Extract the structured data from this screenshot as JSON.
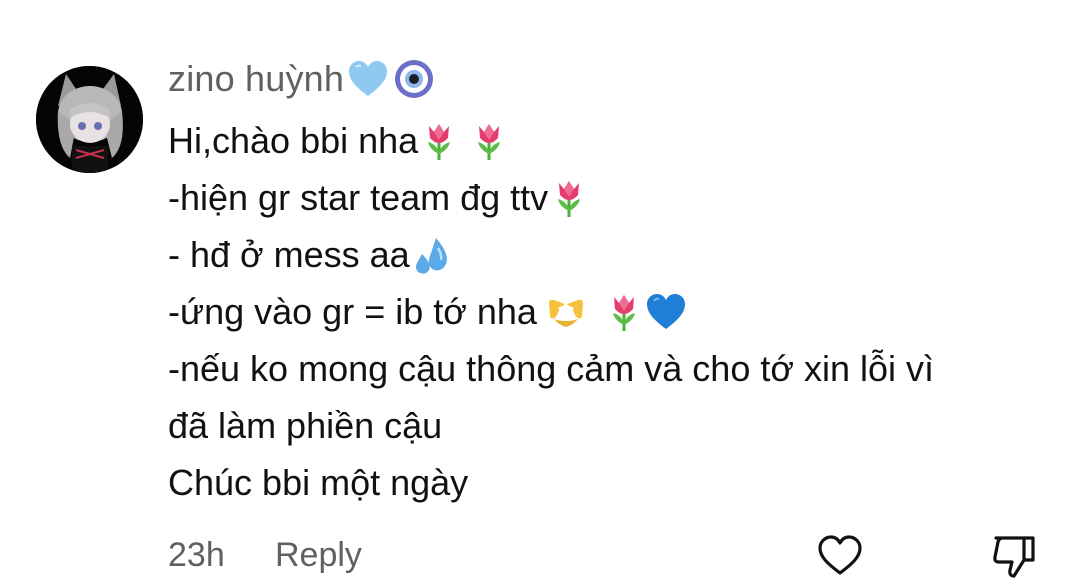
{
  "comment": {
    "author": "zino huỳnh",
    "author_badges": [
      "light-blue-heart-icon",
      "nazar-amulet-icon"
    ],
    "lines": [
      {
        "text": "Hi,chào bbi nha",
        "emojis": [
          "tulip-icon",
          "tulip-icon"
        ]
      },
      {
        "text": "-hiện gr star team đg ttv",
        "emojis": [
          "tulip-icon"
        ]
      },
      {
        "text": "- hđ ở mess aa",
        "emojis": [
          "sweat-droplets-icon"
        ]
      },
      {
        "text": "-ứng vào gr = ib tớ nha ",
        "emojis": [
          "heart-hands-icon",
          "tulip-icon",
          "blue-heart-icon"
        ]
      },
      {
        "text": "-nếu ko mong cậu thông cảm và cho tớ xin lỗi vì",
        "emojis": []
      },
      {
        "text": "đã làm phiền cậu",
        "emojis": []
      },
      {
        "text": "Chúc bbi một ngày",
        "emojis": []
      }
    ],
    "timestamp": "23h",
    "reply_label": "Reply"
  },
  "colors": {
    "secondary_text": "#606060",
    "primary_text": "#111111",
    "background": "#ffffff"
  }
}
